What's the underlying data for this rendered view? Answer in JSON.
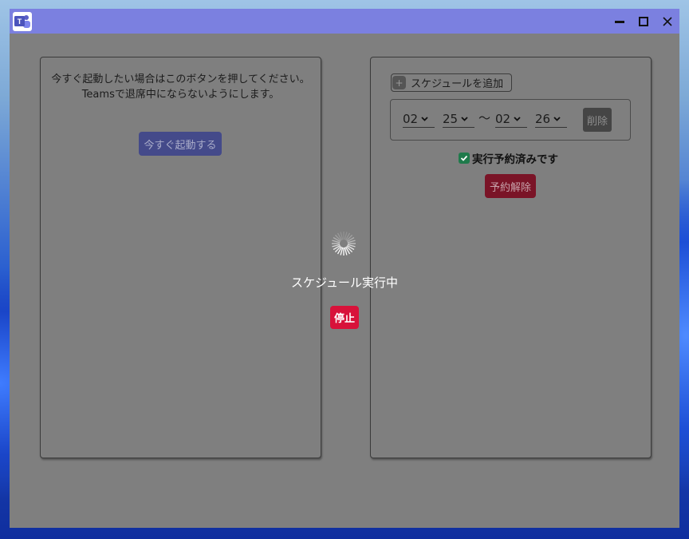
{
  "window": {
    "app_icon": "teams-icon",
    "controls": [
      "minimize-icon",
      "maximize-icon",
      "close-icon"
    ]
  },
  "left_panel": {
    "message_line1": "今すぐ起動したい場合はこのボタンを押してください。",
    "message_line2": "Teamsで退席中にならないようにします。",
    "launch_button": "今すぐ起動する"
  },
  "right_panel": {
    "add_schedule_button": "スケジュールを追加",
    "schedule": {
      "start_hour": "02",
      "start_minute": "25",
      "separator": "〜",
      "end_hour": "02",
      "end_minute": "26",
      "delete_button": "削除"
    },
    "status_text": "実行予約済みです",
    "cancel_button": "予約解除"
  },
  "overlay": {
    "running_text": "スケジュール実行中",
    "stop_button": "停止"
  },
  "colors": {
    "titlebar": "#7b80e0",
    "window_bg": "#7f7f7f",
    "launch_button": "#444a8a",
    "cancel_button": "#7a1427",
    "stop_button": "#d8123a",
    "check": "#1f7a4b"
  }
}
